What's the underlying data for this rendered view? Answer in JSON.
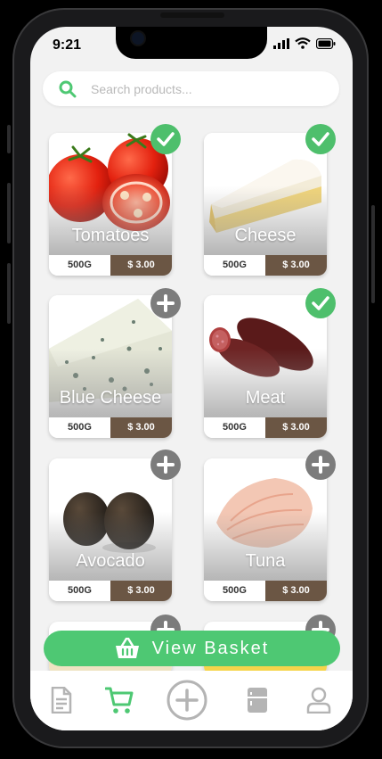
{
  "status": {
    "time": "9:21"
  },
  "search": {
    "placeholder": "Search products..."
  },
  "products": [
    {
      "name": "Tomatoes",
      "weight": "500G",
      "price": "$ 3.00",
      "state": "added"
    },
    {
      "name": "Cheese",
      "weight": "500G",
      "price": "$ 3.00",
      "state": "added"
    },
    {
      "name": "Blue Cheese",
      "weight": "500G",
      "price": "$ 3.00",
      "state": "add"
    },
    {
      "name": "Meat",
      "weight": "500G",
      "price": "$ 3.00",
      "state": "added"
    },
    {
      "name": "Avocado",
      "weight": "500G",
      "price": "$ 3.00",
      "state": "add"
    },
    {
      "name": "Tuna",
      "weight": "500G",
      "price": "$ 3.00",
      "state": "add"
    }
  ],
  "basket": {
    "label": "View Basket"
  },
  "nav": {
    "items": [
      "document-icon",
      "cart-icon",
      "plus-circle-icon",
      "fridge-icon",
      "user-icon"
    ],
    "active": "cart-icon"
  },
  "colors": {
    "accent": "#4ec873",
    "added_badge": "#4ebf6c",
    "add_badge": "#7c7c7c",
    "price_bg": "#6b5644"
  }
}
